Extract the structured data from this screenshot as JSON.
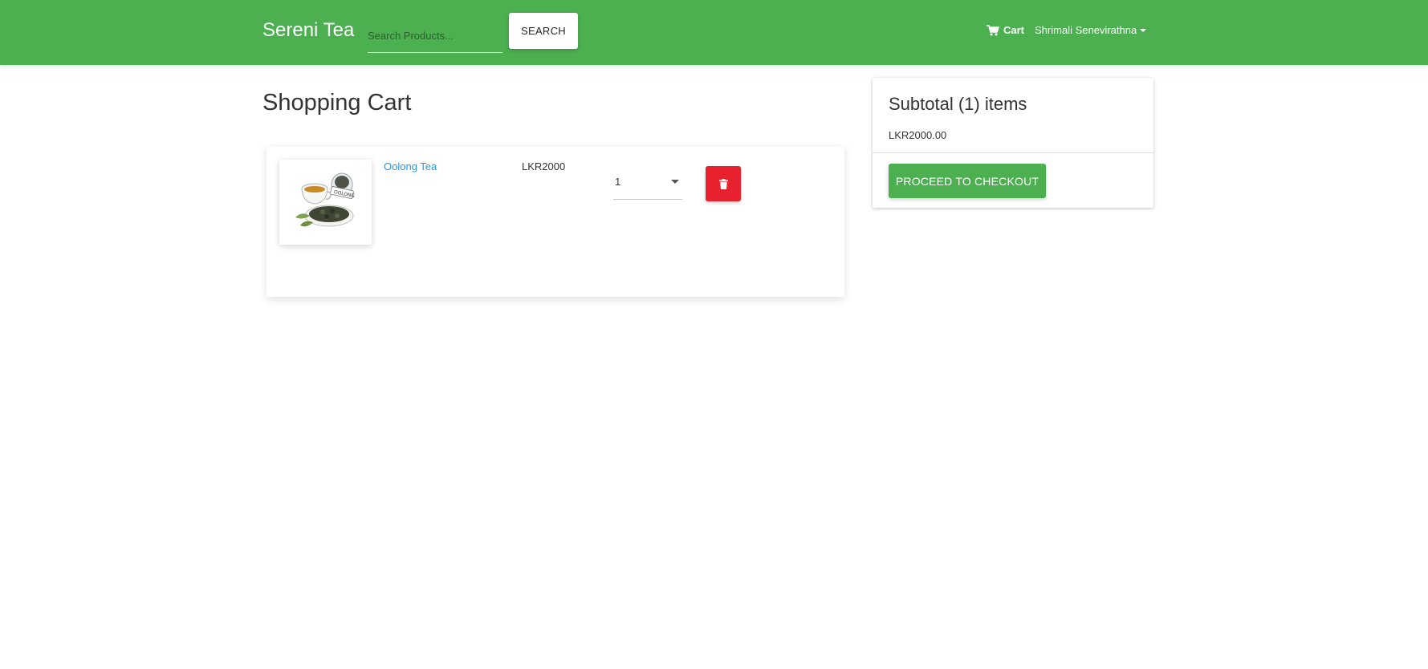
{
  "navbar": {
    "brand": "Sereni Tea",
    "search_placeholder": "Search Products...",
    "search_label": "SEARCH",
    "cart_label": "Cart",
    "cart_icon": "shopping-cart-icon",
    "user_name": "Shrimali Senevirathna",
    "background_color": "#4caf50"
  },
  "page": {
    "title": "Shopping Cart"
  },
  "cart": {
    "items": [
      {
        "name": "Oolong Tea",
        "price": "LKR2000",
        "quantity": "1",
        "image_icon": "oolong-tea-product-image",
        "delete_icon": "trash-icon"
      }
    ]
  },
  "summary": {
    "title": "Subtotal (1) items",
    "amount": "LKR2000.00",
    "checkout_label": "PROCEED TO CHECKOUT"
  },
  "colors": {
    "accent": "#4caf50",
    "link": "#2196f3",
    "danger": "#e8212f"
  }
}
